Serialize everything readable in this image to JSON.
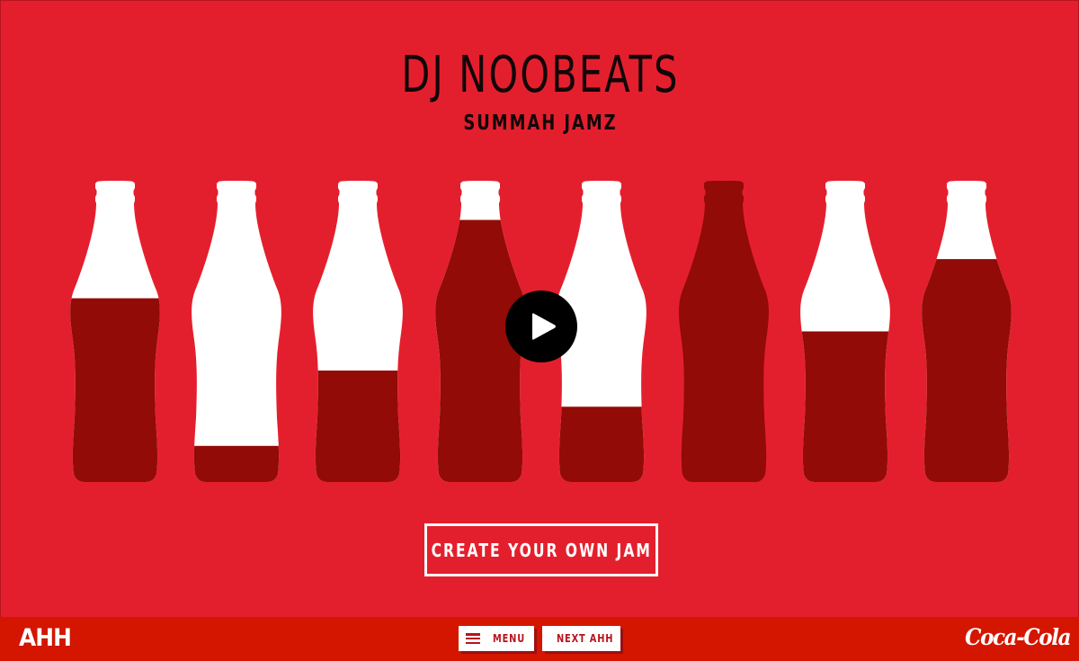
{
  "colors": {
    "background": "#e41f2d",
    "footer": "#d41600",
    "bottle_liquid": "#920b06",
    "bottle_empty": "#ffffff",
    "title_text": "#120608",
    "play_button": "#000000"
  },
  "header": {
    "title": "DJ NOOBEATS",
    "subtitle": "SUMMAH JAMZ"
  },
  "bottles": [
    {
      "fill_level": 0.61,
      "cap": "white"
    },
    {
      "fill_level": 0.12,
      "cap": "white"
    },
    {
      "fill_level": 0.37,
      "cap": "white"
    },
    {
      "fill_level": 0.87,
      "cap": "white"
    },
    {
      "fill_level": 0.25,
      "cap": "white"
    },
    {
      "fill_level": 1.0,
      "cap": "dark"
    },
    {
      "fill_level": 0.5,
      "cap": "white"
    },
    {
      "fill_level": 0.74,
      "cap": "white"
    }
  ],
  "play": {
    "icon": "play-icon"
  },
  "actions": {
    "create_label": "CREATE YOUR OWN JAM"
  },
  "footer": {
    "logo_text": "AHH",
    "menu_label": "MENU",
    "menu_icon": "hamburger-icon",
    "next_label": "NEXT AHH",
    "next_icon": "chevron-right-icon",
    "brand_logo_text": "Coca-Cola"
  }
}
